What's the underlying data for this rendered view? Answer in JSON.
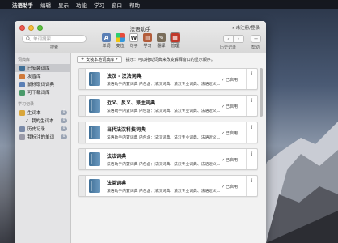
{
  "menubar": {
    "app_name": "法语助手",
    "items": [
      "编辑",
      "显示",
      "功能",
      "学习",
      "窗口",
      "帮助"
    ]
  },
  "window": {
    "title": "法语助手",
    "login_link": "➔ 未注册/登录",
    "search": {
      "placeholder": "单词搜索",
      "label": "搜索"
    },
    "toolbar": [
      {
        "label": "单词",
        "icon": "word-icon",
        "color": "#5a7fb5"
      },
      {
        "label": "变位",
        "icon": "conjugation-icon",
        "color": "#4aa8d8"
      },
      {
        "label": "句子",
        "icon": "sentence-icon",
        "color": "#d9a63b"
      },
      {
        "label": "学习",
        "icon": "study-icon",
        "color": "#b35c3a"
      },
      {
        "label": "翻译",
        "icon": "translate-icon",
        "color": "#7a6d5a"
      },
      {
        "label": "管理",
        "icon": "manage-icon",
        "color": "#c0392b"
      }
    ],
    "history": {
      "back": "‹",
      "forward": "›",
      "label": "历史记录"
    },
    "help": {
      "symbol": "+",
      "label": "帮助"
    }
  },
  "sidebar": {
    "section1": "词典库",
    "items1": [
      {
        "label": "已安装词库",
        "icon": "library-icon",
        "color": "#3f6f96",
        "selected": true
      },
      {
        "label": "发音库",
        "icon": "speaker-icon",
        "color": "#d07a3a"
      },
      {
        "label": "鼠标取词词典",
        "icon": "mouse-icon",
        "color": "#5a7fb5"
      },
      {
        "label": "可下载词库",
        "icon": "download-icon",
        "color": "#4a9a6a"
      }
    ],
    "section2": "学习记录",
    "items2": [
      {
        "label": "生词本",
        "icon": "notebook-icon",
        "color": "#d9a63b",
        "badge": "0",
        "sub": false
      },
      {
        "label": "我的生词本",
        "icon": "check-icon",
        "color": "#6a6a6a",
        "badge": "0",
        "sub": true
      },
      {
        "label": "历史记录",
        "icon": "history-icon",
        "color": "#7a8aa8",
        "badge": "0",
        "sub": false
      },
      {
        "label": "我标注的单词",
        "icon": "tag-icon",
        "color": "#9a9aa8",
        "badge": "0",
        "sub": false
      }
    ]
  },
  "main": {
    "install_button": "安装本地词典库",
    "hint": "提示：可以拖动词典来改变解释窗口的显示顺序。",
    "dictionaries": [
      {
        "title": "法汉 - 汉法词典",
        "desc": "法语助手内置词典  内包含：法汉词典、法汉专业词典、法语近义...",
        "status": "已启用"
      },
      {
        "title": "近义、反义、派生词典",
        "desc": "法语助手内置词典  内包含：法汉词典、法汉专业词典、法语近义...",
        "status": "已启用"
      },
      {
        "title": "当代法汉科技词典",
        "desc": "法语助手内置词典  内包含：法汉词典、法汉专业词典、法语近义...",
        "status": "已启用"
      },
      {
        "title": "法法词典",
        "desc": "法语助手内置词典  内包含：法汉词典、法汉专业词典、法语近义...",
        "status": "已启用"
      },
      {
        "title": "法英词典",
        "desc": "法语助手内置词典  内包含：法汉词典、法汉专业词典、法语近义...",
        "status": "已启用"
      }
    ]
  }
}
